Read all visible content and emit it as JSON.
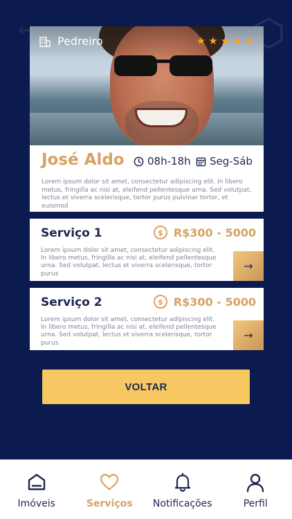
{
  "profile": {
    "role": "Pedreiro",
    "rating_stars": 5,
    "name": "José Aldo",
    "hours": "08h-18h",
    "days": "Seg-Sáb",
    "description": "Lorem ipsum dolor sit amet, consectetur adipiscing elit. In libero metus, fringilla ac nisi at, eleifend pellentesque urna. Sed volutpat, lectus et viverra scelerisque, tortor purus pulvinar tortor, et euismod",
    "icons": {
      "role": "building-icon",
      "hours": "clock-icon",
      "days": "calendar-icon",
      "star": "star-icon"
    }
  },
  "services": [
    {
      "title": "Serviço 1",
      "price": "R$300 - 5000",
      "description": "Lorem ipsum dolor sit amet, consectetur adipiscing elit. In libero metus, fringilla ac nisi at, eleifend pellentesque urna. Sed volutpat, lectus et viverra scelerisque, tortor purus"
    },
    {
      "title": "Serviço 2",
      "price": "R$300 - 5000",
      "description": "Lorem ipsum dolor sit amet, consectetur adipiscing elit. In libero metus, fringilla ac nisi at, eleifend pellentesque urna. Sed volutpat, lectus et viverra scelerisque, tortor purus"
    }
  ],
  "back_button": {
    "label": "VOLTAR"
  },
  "nav": {
    "items": [
      {
        "label": "Imóveis",
        "icon": "home-icon"
      },
      {
        "label": "Serviços",
        "icon": "heart-icon",
        "active": true
      },
      {
        "label": "Notificações",
        "icon": "bell-icon"
      },
      {
        "label": "Perfil",
        "icon": "user-icon"
      }
    ]
  },
  "colors": {
    "background": "#0b1a4f",
    "accent_gold": "#d6a263",
    "button_yellow": "#f7c862",
    "text_dark": "#1d2750",
    "star": "#f5a623"
  }
}
